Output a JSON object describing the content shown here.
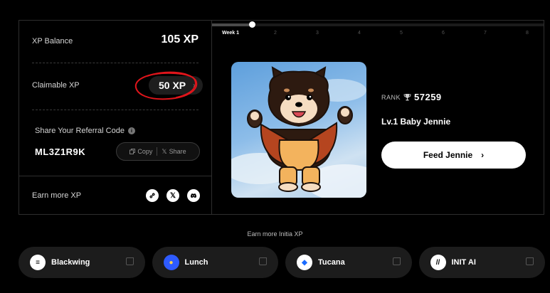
{
  "xp": {
    "balance_label": "XP Balance",
    "balance_value": "105 XP"
  },
  "claim": {
    "label": "Claimable XP",
    "button_value": "50 XP",
    "button_chevron": "›"
  },
  "referral": {
    "label": "Share Your Referral Code",
    "code": "ML3Z1R9K",
    "copy_label": "Copy",
    "share_label": "Share"
  },
  "earn": {
    "label": "Earn more XP",
    "socials": [
      "link-icon",
      "x-icon",
      "discord-icon"
    ]
  },
  "timeline": {
    "weeks": [
      "Week 1",
      "2",
      "3",
      "4",
      "5",
      "6",
      "7",
      "8"
    ],
    "current_week_index": 0,
    "progress": 0.12
  },
  "nft": {
    "image_icon": "pomeranian-character-icon"
  },
  "profile": {
    "rank_label": "RANK",
    "rank_icon": "trophy-icon",
    "rank_value": "57259",
    "level": "Lv.1 Baby Jennie",
    "feed_label": "Feed Jennie",
    "feed_chevron": "›"
  },
  "initia": {
    "heading": "Earn more Initia XP",
    "partners": [
      {
        "name": "Blackwing",
        "logo": "blackwing-logo",
        "logo_bg": "#ffffff",
        "logo_fg": "#000000"
      },
      {
        "name": "Lunch",
        "logo": "lunch-logo",
        "logo_bg": "#2e5bff",
        "logo_fg": "#ffd34d"
      },
      {
        "name": "Tucana",
        "logo": "tucana-logo",
        "logo_bg": "#ffffff",
        "logo_fg": "#1c6cff"
      },
      {
        "name": "INIT AI",
        "logo": "init-ai-logo",
        "logo_bg": "#ffffff",
        "logo_fg": "#000000"
      }
    ]
  },
  "colors": {
    "background": "#000000",
    "panel_border": "#2e2e2e",
    "annotation": "#e0151b",
    "button": "#ffffff"
  }
}
